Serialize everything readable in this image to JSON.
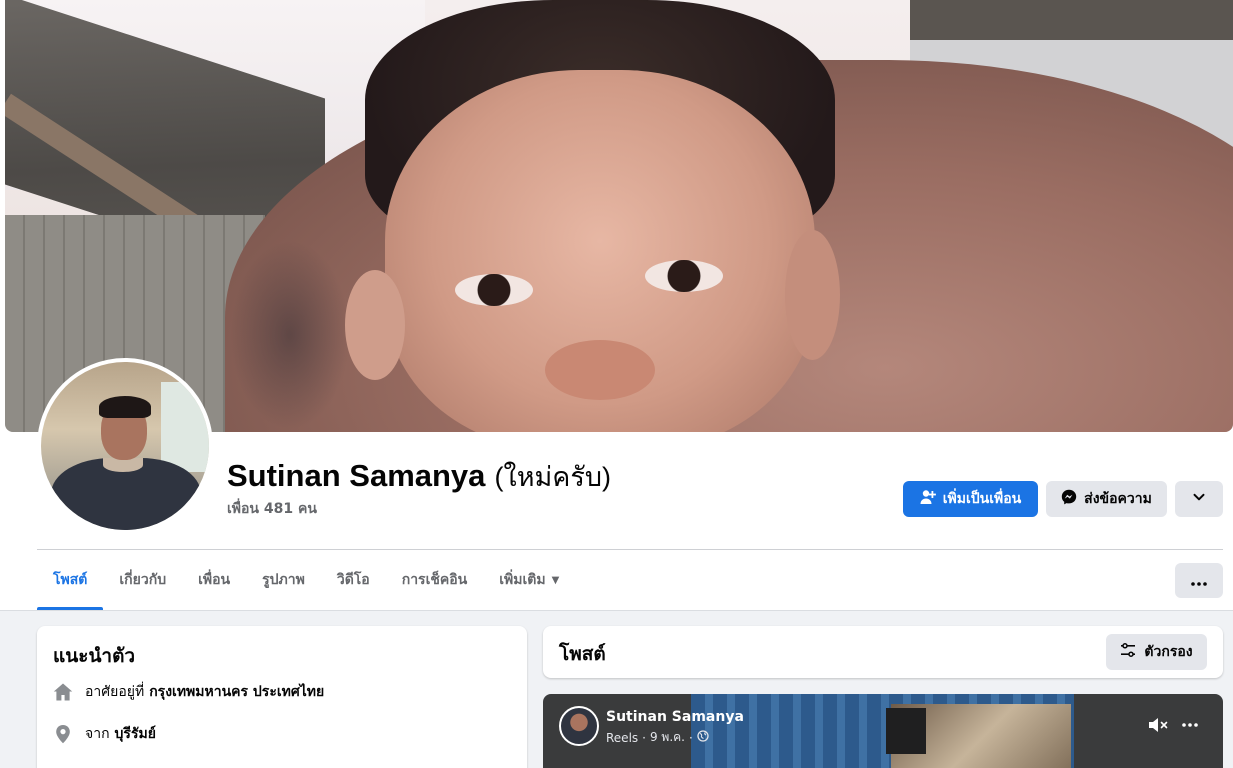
{
  "profile": {
    "name": "Sutinan Samanya",
    "alt_name": "(ใหม่ครับ)",
    "friends_count": "เพื่อน 481 คน"
  },
  "actions": {
    "add_friend_label": "เพิ่มเป็นเพื่อน",
    "message_label": "ส่งข้อความ"
  },
  "tabs": [
    {
      "label": "โพสต์",
      "active": true
    },
    {
      "label": "เกี่ยวกับ"
    },
    {
      "label": "เพื่อน"
    },
    {
      "label": "รูปภาพ"
    },
    {
      "label": "วิดีโอ"
    },
    {
      "label": "การเช็คอิน"
    },
    {
      "label": "เพิ่มเติม"
    }
  ],
  "intro": {
    "title": "แนะนำตัว",
    "items": [
      {
        "icon": "home-icon",
        "prefix": "อาศัยอยู่ที่",
        "value": "กรุงเทพมหานคร ประเทศไทย"
      },
      {
        "icon": "location-pin-icon",
        "prefix": "จาก",
        "value": "บุรีรัมย์"
      }
    ]
  },
  "posts": {
    "title": "โพสต์",
    "filter_label": "ตัวกรอง"
  },
  "reel_post": {
    "author": "Sutinan Samanya",
    "source": "Reels",
    "date": "9 พ.ค.",
    "separator": "·"
  },
  "colors": {
    "accent": "#1b74e4",
    "page_bg": "#f0f2f5",
    "button_gray": "#e4e6eb"
  }
}
